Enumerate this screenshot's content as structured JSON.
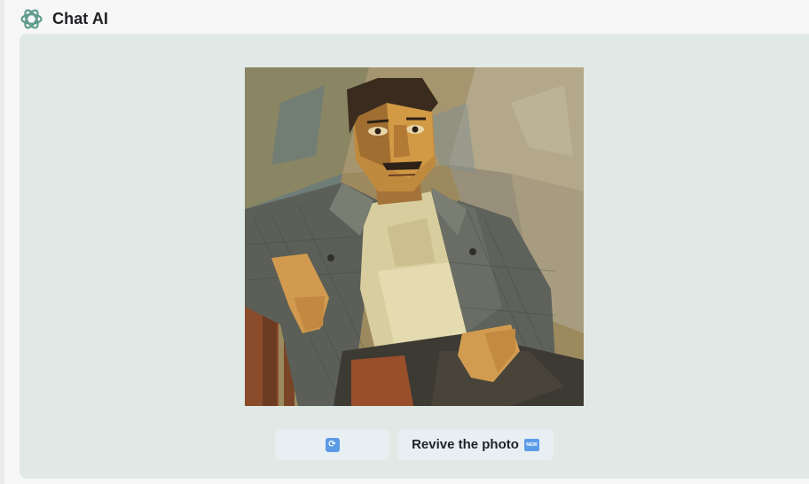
{
  "app": {
    "title": "Chat AI",
    "logo_icon": "openai-knot-icon",
    "accent_color": "#5f9c8b"
  },
  "card": {
    "background": "#e0e9e5",
    "image": {
      "subject": "cubist-portrait-man-seated-icon"
    }
  },
  "actions": {
    "refresh_icon": "refresh-emoji-icon",
    "revive_label": "Revive the photo",
    "new_badge": "NEW"
  }
}
